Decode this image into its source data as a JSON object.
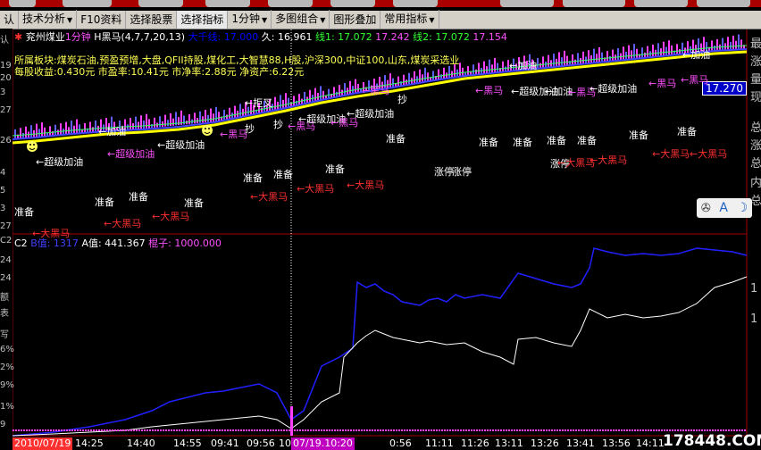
{
  "toolbar": {
    "items": [
      {
        "label": "认",
        "dd": false
      },
      {
        "label": "技术分析",
        "dd": true
      },
      {
        "label": "F10资料",
        "dd": false
      },
      {
        "label": "选择股票",
        "dd": false
      },
      {
        "label": "选择指标",
        "dd": false
      },
      {
        "label": "1分钟",
        "dd": true
      },
      {
        "label": "多图组合",
        "dd": true
      },
      {
        "label": "图形叠加",
        "dd": false
      },
      {
        "label": "常用指标",
        "dd": true
      }
    ]
  },
  "header": {
    "stock": "兖州煤业",
    "period": "1分钟",
    "indicator": "H黑马(4,7,7,20,13)",
    "big_ten": "大千线: 17.000",
    "jiu": "久: 16.961",
    "line1": "线1: 17.072",
    "v2": "17.242",
    "line2": "线2: 17.072",
    "v3": "17.154"
  },
  "info": {
    "sectors": "所属板块:煤炭石油,预盈预增,大盘,QFII持股,煤化工,大智慧88,H股,沪深300,中证100,山东,煤炭采选业",
    "financial": "每股收益:0.430元 市盈率:10.41元 市净率:2.88元 净资产:6.22元"
  },
  "price_box": "17.270",
  "c2": {
    "title": "C2",
    "b_val": "B值: 1317",
    "a_val": "A值: 441.367",
    "stick": "棍子: 1000.000"
  },
  "left_axis": [
    "认",
    "19",
    "20",
    "3",
    "27",
    "26",
    "4",
    "5",
    "3",
    "27",
    "C2",
    "24",
    "24",
    "额",
    "表",
    "写",
    "6%",
    "2%",
    "9%",
    "1%",
    "9"
  ],
  "right_axis": [
    "最",
    "涨",
    "量",
    "现",
    "总",
    "涨",
    "总",
    "内",
    "总",
    "1",
    "1"
  ],
  "time_axis": [
    "2010/07/19",
    "14:25",
    "14:40",
    "14:55",
    "09:41",
    "09:56",
    "10:",
    "07/19.10:20",
    "0:56",
    "11:11",
    "11:26",
    "13:11",
    "13:26",
    "13:41",
    "13:56",
    "14:11"
  ],
  "widget": {
    "a": "A",
    "moon": "☽"
  },
  "watermark": "178448.COM",
  "signals": {
    "jiayou": "加油",
    "chaoji": "超级加油",
    "heima": "黑马",
    "dahei": "大黑马",
    "zhunbei": "准备",
    "chao": "抄",
    "juyue": "拒叉",
    "zhangting": "涨停",
    "zt2": "涨停",
    "zt3": "涨停",
    "bolang": "超级加油",
    "shijia": "加油",
    "heimaa": "黑马",
    "zhangliu": "超级加油"
  }
}
